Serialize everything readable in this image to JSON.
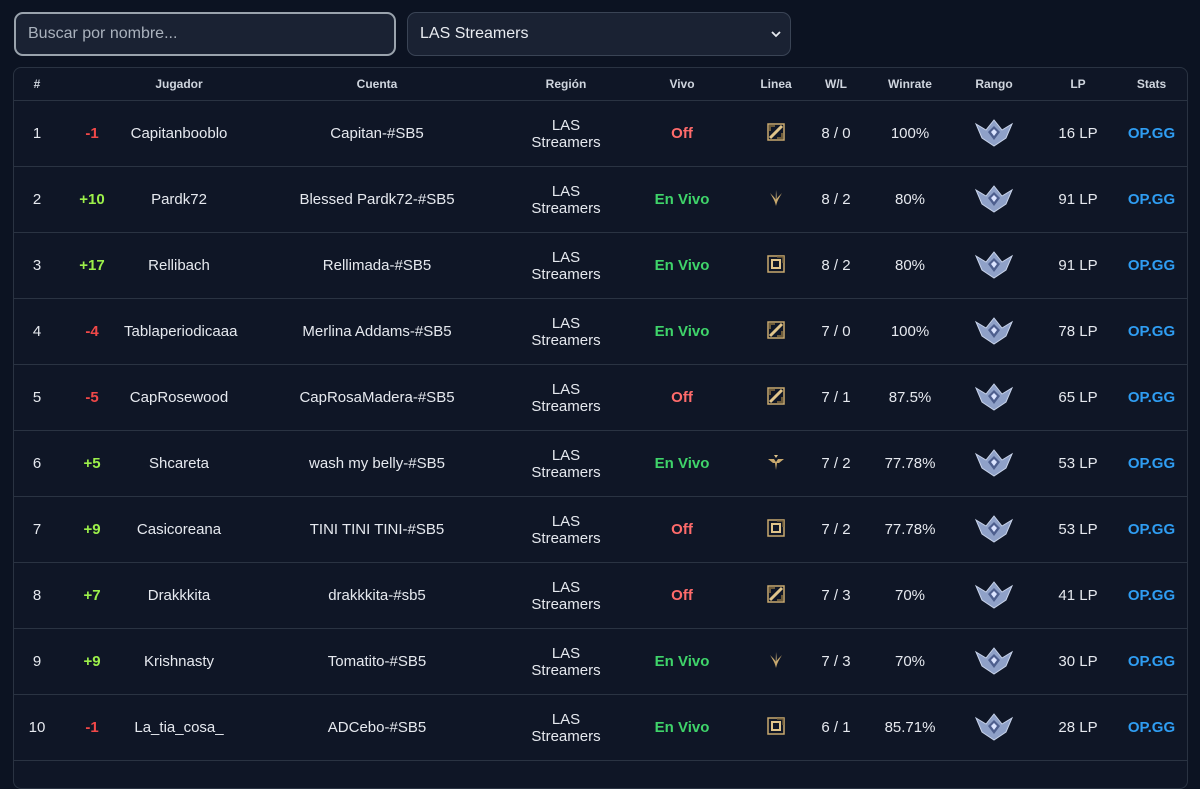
{
  "search": {
    "placeholder": "Buscar por nombre..."
  },
  "filter": {
    "selected": "LAS Streamers"
  },
  "table": {
    "headers": [
      "#",
      "",
      "Jugador",
      "Cuenta",
      "Región",
      "Vivo",
      "Linea",
      "W/L",
      "Winrate",
      "Rango",
      "LP",
      "Stats"
    ],
    "rows": [
      {
        "rank": "1",
        "change": "-1",
        "player": "Capitanbooblo",
        "account": "Capitan-#SB5",
        "region": "LAS Streamers",
        "live": "Off",
        "lane": "mid-lane-icon",
        "wl": "8 / 0",
        "winrate": "100%",
        "lp": "16 LP",
        "stats": "OP.GG"
      },
      {
        "rank": "2",
        "change": "+10",
        "player": "Pardk72",
        "account": "Blessed Pardk72-#SB5",
        "region": "LAS Streamers",
        "live": "En Vivo",
        "lane": "jungle-lane-icon",
        "wl": "8 / 2",
        "winrate": "80%",
        "lp": "91 LP",
        "stats": "OP.GG"
      },
      {
        "rank": "3",
        "change": "+17",
        "player": "Rellibach",
        "account": "Rellimada-#SB5",
        "region": "LAS Streamers",
        "live": "En Vivo",
        "lane": "bottom-lane-icon",
        "wl": "8 / 2",
        "winrate": "80%",
        "lp": "91 LP",
        "stats": "OP.GG"
      },
      {
        "rank": "4",
        "change": "-4",
        "player": "Tablaperiodicaaa",
        "account": "Merlina Addams-#SB5",
        "region": "LAS Streamers",
        "live": "En Vivo",
        "lane": "mid-lane-icon",
        "wl": "7 / 0",
        "winrate": "100%",
        "lp": "78 LP",
        "stats": "OP.GG"
      },
      {
        "rank": "5",
        "change": "-5",
        "player": "CapRosewood",
        "account": "CapRosaMadera-#SB5",
        "region": "LAS Streamers",
        "live": "Off",
        "lane": "mid-lane-icon",
        "wl": "7 / 1",
        "winrate": "87.5%",
        "lp": "65 LP",
        "stats": "OP.GG"
      },
      {
        "rank": "6",
        "change": "+5",
        "player": "Shcareta",
        "account": "wash my belly-#SB5",
        "region": "LAS Streamers",
        "live": "En Vivo",
        "lane": "support-lane-icon",
        "wl": "7 / 2",
        "winrate": "77.78%",
        "lp": "53 LP",
        "stats": "OP.GG"
      },
      {
        "rank": "7",
        "change": "+9",
        "player": "Casicoreana",
        "account": "TINI TINI TINI-#SB5",
        "region": "LAS Streamers",
        "live": "Off",
        "lane": "bottom-lane-icon",
        "wl": "7 / 2",
        "winrate": "77.78%",
        "lp": "53 LP",
        "stats": "OP.GG"
      },
      {
        "rank": "8",
        "change": "+7",
        "player": "Drakkkita",
        "account": "drakkkita-#sb5",
        "region": "LAS Streamers",
        "live": "Off",
        "lane": "mid-lane-icon",
        "wl": "7 / 3",
        "winrate": "70%",
        "lp": "41 LP",
        "stats": "OP.GG"
      },
      {
        "rank": "9",
        "change": "+9",
        "player": "Krishnasty",
        "account": "Tomatito-#SB5",
        "region": "LAS Streamers",
        "live": "En Vivo",
        "lane": "jungle-lane-icon",
        "wl": "7 / 3",
        "winrate": "70%",
        "lp": "30 LP",
        "stats": "OP.GG"
      },
      {
        "rank": "10",
        "change": "-1",
        "player": "La_tia_cosa_",
        "account": "ADCebo-#SB5",
        "region": "LAS Streamers",
        "live": "En Vivo",
        "lane": "bottom-lane-icon",
        "wl": "6 / 1",
        "winrate": "85.71%",
        "lp": "28 LP",
        "stats": "OP.GG"
      }
    ]
  }
}
